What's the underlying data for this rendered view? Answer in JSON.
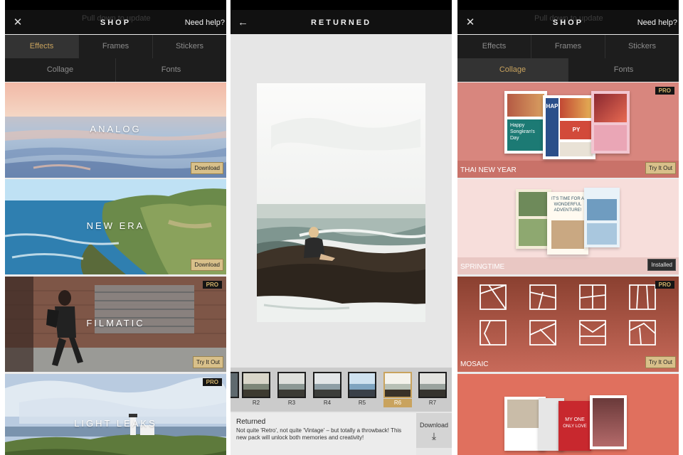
{
  "shop_left": {
    "header": {
      "pull_text": "Pull down to update",
      "title": "SHOP",
      "help": "Need help?"
    },
    "tabs_row1": [
      "Effects",
      "Frames",
      "Stickers"
    ],
    "tabs_row2": [
      "Collage",
      "Fonts"
    ],
    "active_tab": "Effects",
    "cards": [
      {
        "title": "ANALOG",
        "button": "Download",
        "pro": ""
      },
      {
        "title": "NEW ERA",
        "button": "Download",
        "pro": ""
      },
      {
        "title": "FILMATIC",
        "button": "Try It Out",
        "pro": "PRO"
      },
      {
        "title": "LIGHT LEAKS",
        "button": "",
        "pro": "PRO"
      }
    ]
  },
  "detail": {
    "header": {
      "title": "RETURNED"
    },
    "thumbs": [
      "R2",
      "R3",
      "R4",
      "R5",
      "R6",
      "R7"
    ],
    "selected_thumb": "R6",
    "pack_name": "Returned",
    "pack_desc": "Not quite 'Retro', not quite 'Vintage' – but totally a throwback! This new pack will unlock both memories and creativity!",
    "download_label": "Download"
  },
  "shop_right": {
    "header": {
      "pull_text": "Pull down to update",
      "title": "SHOP",
      "help": "Need help?"
    },
    "tabs_row1": [
      "Effects",
      "Frames",
      "Stickers"
    ],
    "tabs_row2": [
      "Collage",
      "Fonts"
    ],
    "active_tab": "Collage",
    "cards": [
      {
        "title": "THAI NEW YEAR",
        "button": "Try It Out",
        "pro": "PRO"
      },
      {
        "title": "SPRINGTIME",
        "button": "Installed",
        "pro": ""
      },
      {
        "title": "MOSAIC",
        "button": "Try It Out",
        "pro": "PRO"
      }
    ],
    "collage_texts": {
      "happy": "Happy Songkran's Day",
      "hap": "HAP",
      "py": "PY",
      "springtime_note": "IT'S TIME FOR A WONDERFUL ADVENTURE!",
      "my_one": "MY ONE",
      "only_love": "ONLY LOVE"
    }
  },
  "colors": {
    "accent_gold": "#c9a35e",
    "header_bg": "#111111",
    "tab_bg": "#1d1d1d"
  }
}
